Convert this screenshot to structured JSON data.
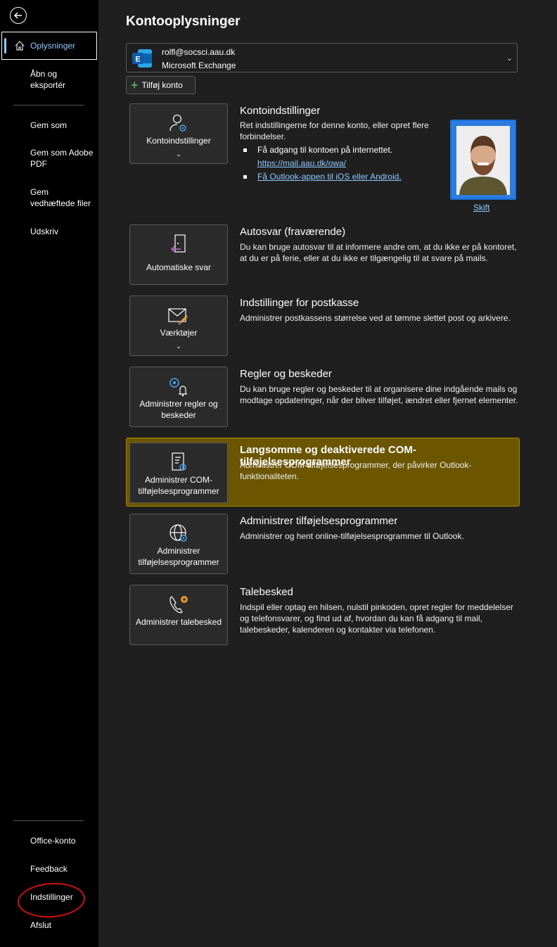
{
  "sidebar": {
    "selected": "Oplysninger",
    "items": [
      "Åbn og eksportér",
      "Gem som",
      "Gem som Adobe PDF",
      "Gem vedhæftede filer",
      "Udskriv"
    ],
    "bottom_items": [
      "Office-konto",
      "Feedback",
      "Indstillinger",
      "Afslut"
    ]
  },
  "main": {
    "title": "Kontooplysninger",
    "account": {
      "email": "rolfl@socsci.aau.dk",
      "type": "Microsoft Exchange"
    },
    "add_account_label": "Tilføj konto",
    "photo_change_label": "Skift",
    "sections": [
      {
        "tile_label": "Kontoindstillinger",
        "title": "Kontoindstillinger",
        "description": "Ret indstillingerne for denne konto, eller opret flere forbindelser.",
        "bullet_1": "Få adgang til kontoen på internettet.",
        "link_1": "https://mail.aau.dk/owa/",
        "link_2": "Få Outlook-appen til iOS eller Android."
      },
      {
        "tile_label": "Automatiske svar",
        "title": "Autosvar (fraværende)",
        "description": "Du kan bruge autosvar til at informere andre om, at du ikke er på kontoret, at du er på ferie, eller at du ikke er tilgængelig til at svare på mails."
      },
      {
        "tile_label": "Værktøjer",
        "title": "Indstillinger for postkasse",
        "description": "Administrer postkassens størrelse ved at tømme slettet post og arkivere."
      },
      {
        "tile_label": "Administrer regler og beskeder",
        "title": "Regler og beskeder",
        "description": "Du kan bruge regler og beskeder til at organisere dine indgående mails og modtage opdateringer, når der bliver tilføjet, ændret eller fjernet elementer."
      },
      {
        "tile_label": "Administrer COM-tilføjelsesprogrammer",
        "title": "Langsomme og deaktiverede COM-tilføjelsesprogrammer",
        "description": "Administrer COM-tilføjelsesprogrammer, der påvirker Outlook-funktionaliteten."
      },
      {
        "tile_label": "Administrer tilføjelsesprogrammer",
        "title": "Administrer tilføjelsesprogrammer",
        "description": "Administrer og hent online-tilføjelsesprogrammer til Outlook."
      },
      {
        "tile_label": "Administrer talebesked",
        "title": "Talebesked",
        "description": "Indspil eller optag en hilsen, nulstil pinkoden, opret regler for meddelelser og telefonsvarer, og find ud af, hvordan du kan få adgang til mail, talebeskeder, kalenderen og kontakter via telefonen."
      }
    ]
  },
  "colors": {
    "accent": "#8fc8ff",
    "highlight": "#6b5500",
    "annotation": "#d40f0f"
  }
}
